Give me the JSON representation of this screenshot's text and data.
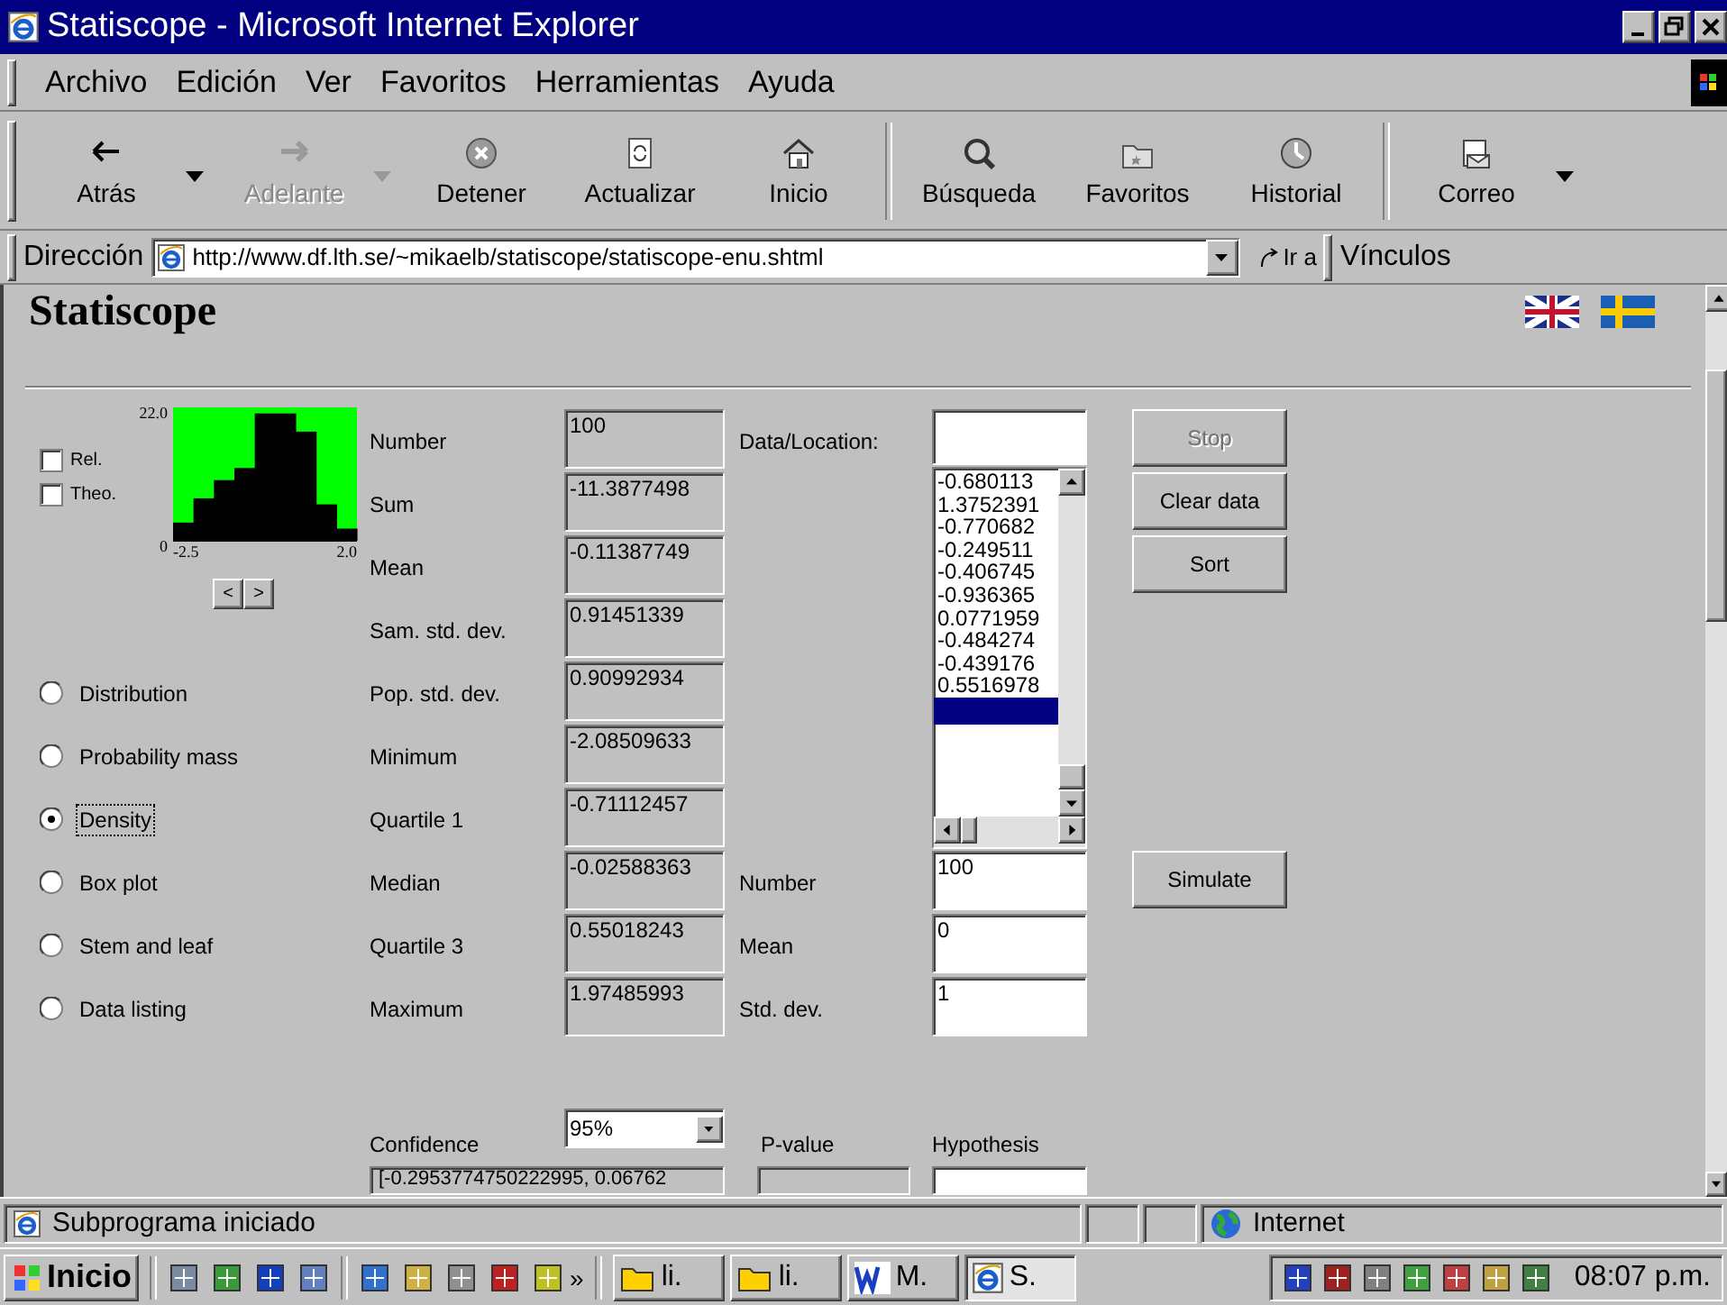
{
  "window": {
    "title": "Statiscope - Microsoft Internet Explorer"
  },
  "menu": [
    {
      "label": "Archivo"
    },
    {
      "label": "Edición"
    },
    {
      "label": "Ver"
    },
    {
      "label": "Favoritos"
    },
    {
      "label": "Herramientas"
    },
    {
      "label": "Ayuda"
    }
  ],
  "toolbar": {
    "groups": [
      [
        {
          "label": "Atrás",
          "disabled": false,
          "dropdown": true
        },
        {
          "label": "Adelante",
          "disabled": true,
          "dropdown": true
        },
        {
          "label": "Detener",
          "disabled": false,
          "dropdown": false
        },
        {
          "label": "Actualizar",
          "disabled": false,
          "dropdown": false
        },
        {
          "label": "Inicio",
          "disabled": false,
          "dropdown": false
        }
      ],
      [
        {
          "label": "Búsqueda",
          "disabled": false,
          "dropdown": false
        },
        {
          "label": "Favoritos",
          "disabled": false,
          "dropdown": false
        },
        {
          "label": "Historial",
          "disabled": false,
          "dropdown": false
        }
      ],
      [
        {
          "label": "Correo",
          "disabled": false,
          "dropdown": true
        }
      ]
    ]
  },
  "address_bar": {
    "label": "Dirección",
    "url": "http://www.df.lth.se/~mikaelb/statiscope/statiscope-enu.shtml",
    "go": "Ir a",
    "links": "Vínculos"
  },
  "applet": {
    "heading": "Statiscope",
    "options": [
      {
        "label": "Rel.",
        "checked": false
      },
      {
        "label": "Theo.",
        "checked": false
      }
    ],
    "histogram": {
      "chart_data": {
        "type": "bar",
        "values": [
          3,
          7,
          10,
          12,
          21,
          21,
          18,
          6,
          2
        ],
        "ylim": [
          0,
          22
        ],
        "yticks": [
          0,
          {
            "value": 22,
            "label": "22.0"
          }
        ]
      },
      "x_axis_labels": [
        "-2.5",
        "2.0"
      ],
      "pager": [
        "<",
        ">"
      ]
    },
    "views": [
      {
        "label": "Distribution",
        "selected": false,
        "focused": false
      },
      {
        "label": "Probability mass",
        "selected": false,
        "focused": false
      },
      {
        "label": "Density",
        "selected": true,
        "focused": true
      },
      {
        "label": "Box plot",
        "selected": false,
        "focused": false
      },
      {
        "label": "Stem and leaf",
        "selected": false,
        "focused": false
      },
      {
        "label": "Data listing",
        "selected": false,
        "focused": false
      }
    ],
    "stats": [
      {
        "label": "Number",
        "value": "100"
      },
      {
        "label": "Sum",
        "value": "-11.3877498"
      },
      {
        "label": "Mean",
        "value": "-0.11387749"
      },
      {
        "label": "Sam. std. dev.",
        "value": "0.91451339"
      },
      {
        "label": "Pop. std. dev.",
        "value": "0.90992934"
      },
      {
        "label": "Minimum",
        "value": "-2.08509633"
      },
      {
        "label": "Quartile 1",
        "value": "-0.71112457"
      },
      {
        "label": "Median",
        "value": "-0.02588363"
      },
      {
        "label": "Quartile 3",
        "value": "0.55018243"
      },
      {
        "label": "Maximum",
        "value": "1.97485993"
      }
    ],
    "data_location": {
      "label": "Data/Location:"
    },
    "data_list": [
      "-0.680113",
      "1.3752391",
      "-0.770682",
      "-0.249511",
      "-0.406745",
      "-0.936365",
      "0.0771959",
      "-0.484274",
      "-0.439176",
      "0.5516978"
    ],
    "buttons": [
      {
        "label": "Stop",
        "disabled": true
      },
      {
        "label": "Clear data",
        "disabled": false
      },
      {
        "label": "Sort",
        "disabled": false
      }
    ],
    "simulation": {
      "fields": [
        {
          "label": "Number",
          "value": "100"
        },
        {
          "label": "Mean",
          "value": "0"
        },
        {
          "label": "Std. dev.",
          "value": "1"
        }
      ],
      "button": "Simulate"
    },
    "confidence": {
      "label": "Confidence",
      "value": "95%",
      "interval": "[-0.2953774750222995, 0.06762"
    },
    "p_value": {
      "label": "P-value"
    },
    "hypothesis": {
      "label": "Hypothesis"
    }
  },
  "status_bar": {
    "message": "Subprograma iniciado",
    "zone": "Internet"
  },
  "taskbar": {
    "start": "Inicio",
    "tasks": [
      {
        "label": "li.",
        "selected": false
      },
      {
        "label": "li.",
        "selected": false
      },
      {
        "label": "M.",
        "selected": false
      },
      {
        "label": "S.",
        "selected": true
      }
    ],
    "more": "»",
    "clock": "08:07 p.m."
  }
}
